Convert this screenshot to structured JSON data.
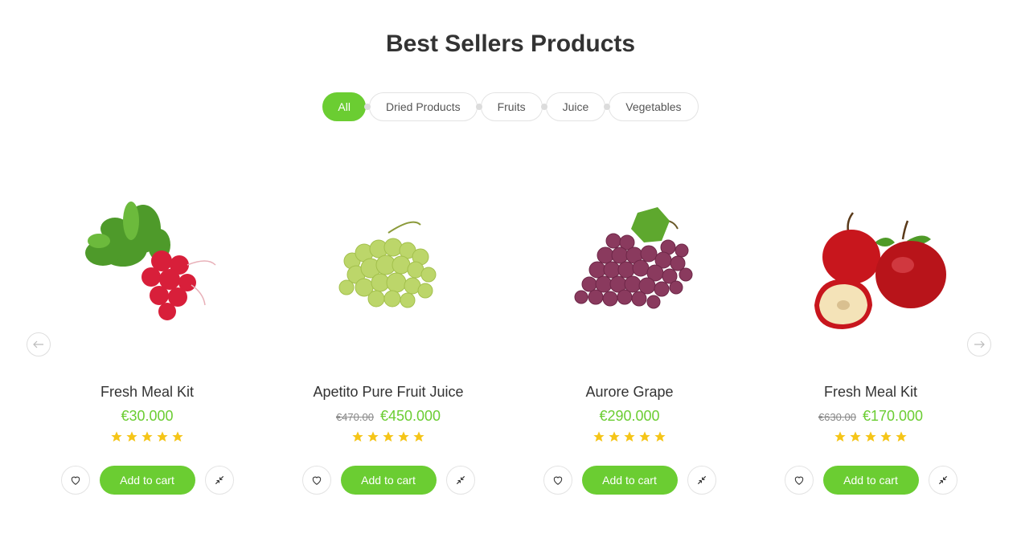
{
  "section": {
    "title": "Best Sellers Products"
  },
  "tabs": [
    {
      "label": "All",
      "active": true
    },
    {
      "label": "Dried Products",
      "active": false
    },
    {
      "label": "Fruits",
      "active": false
    },
    {
      "label": "Juice",
      "active": false
    },
    {
      "label": "Vegetables",
      "active": false
    }
  ],
  "products": [
    {
      "name": "Fresh Meal Kit",
      "old_price": "",
      "price": "€30.000",
      "rating": 5,
      "cart_label": "Add to cart",
      "image": "radish-icon"
    },
    {
      "name": "Apetito Pure Fruit Juice",
      "old_price": "€470.00",
      "price": "€450.000",
      "rating": 5,
      "cart_label": "Add to cart",
      "image": "green-grapes-icon"
    },
    {
      "name": "Aurore Grape",
      "old_price": "",
      "price": "€290.000",
      "rating": 5,
      "cart_label": "Add to cart",
      "image": "red-grapes-icon"
    },
    {
      "name": "Fresh Meal Kit",
      "old_price": "€630.00",
      "price": "€170.000",
      "rating": 5,
      "cart_label": "Add to cart",
      "image": "apples-icon"
    }
  ],
  "colors": {
    "accent": "#6bcd32",
    "star": "#f5c518",
    "text": "#333333"
  }
}
